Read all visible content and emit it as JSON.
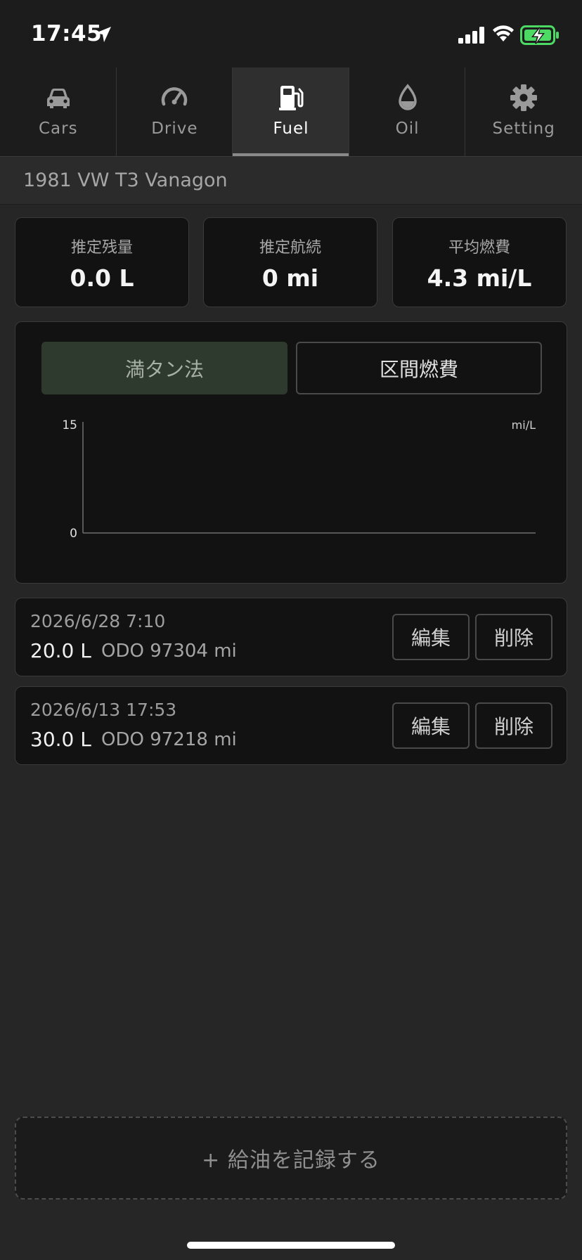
{
  "status_bar": {
    "time": "17:45"
  },
  "tabs": [
    {
      "label": "Cars",
      "icon": "car-icon",
      "active": false
    },
    {
      "label": "Drive",
      "icon": "speedometer-icon",
      "active": false
    },
    {
      "label": "Fuel",
      "icon": "fuel-pump-icon",
      "active": true
    },
    {
      "label": "Oil",
      "icon": "oil-drop-icon",
      "active": false
    },
    {
      "label": "Setting",
      "icon": "gear-icon",
      "active": false
    }
  ],
  "car": {
    "name": "1981 VW T3 Vanagon"
  },
  "stats": [
    {
      "label": "推定残量",
      "value": "0.0 L"
    },
    {
      "label": "推定航続",
      "value": "0 mi"
    },
    {
      "label": "平均燃費",
      "value": "4.3 mi/L"
    }
  ],
  "chart_controls": {
    "full_tank_label": "満タン法",
    "segment_label": "区間燃費"
  },
  "chart_data": {
    "type": "line",
    "unit_label": "mi/L",
    "ylim": [
      0,
      15
    ],
    "y_ticks": [
      "15",
      "0"
    ],
    "series": [],
    "grid": false
  },
  "records": [
    {
      "datetime": "2026/6/28 7:10",
      "amount": "20.0 L",
      "odo": "ODO 97304 mi",
      "edit_label": "編集",
      "delete_label": "削除"
    },
    {
      "datetime": "2026/6/13 17:53",
      "amount": "30.0 L",
      "odo": "ODO 97218 mi",
      "edit_label": "編集",
      "delete_label": "削除"
    }
  ],
  "add_button": {
    "label": "+ 給油を記録する"
  },
  "colors": {
    "background": "#262626",
    "card": "#121212",
    "active_segment": "#2e3a2e",
    "battery_green": "#4cd964"
  }
}
